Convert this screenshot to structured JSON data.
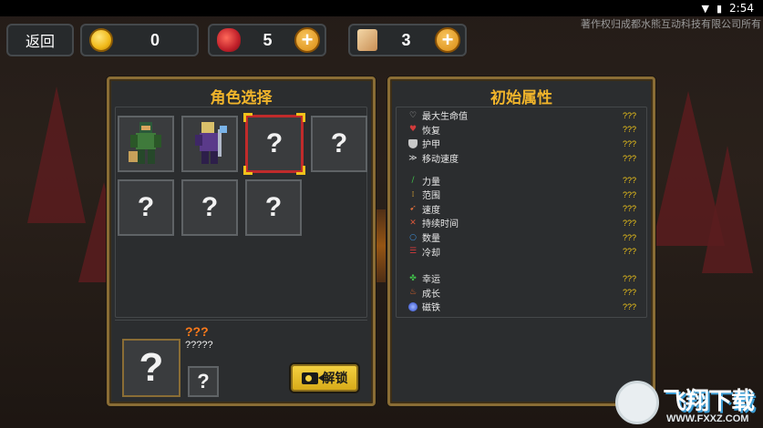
{
  "status_bar": {
    "time": "2:54"
  },
  "copyright": "著作权归成都水熊互动科技有限公司所有",
  "header": {
    "back_label": "返回",
    "gold": {
      "value": "0",
      "icon": "gold-coin-icon"
    },
    "apple": {
      "value": "5",
      "icon": "apple-icon"
    },
    "scroll": {
      "value": "3",
      "icon": "scroll-icon"
    },
    "plus_label": "+"
  },
  "character_select": {
    "title": "角色选择",
    "slots": [
      {
        "label": "",
        "state": "unlocked",
        "name": "green-warrior"
      },
      {
        "label": "",
        "state": "unlocked",
        "name": "purple-mage"
      },
      {
        "label": "?",
        "state": "selected"
      },
      {
        "label": "?",
        "state": "locked"
      },
      {
        "label": "?",
        "state": "locked"
      },
      {
        "label": "?",
        "state": "locked"
      },
      {
        "label": "?",
        "state": "locked"
      }
    ],
    "detail": {
      "big_slot": "?",
      "small_slot": "?",
      "name": "???",
      "description": "?????",
      "unlock_label": "解锁"
    }
  },
  "attributes": {
    "title": "初始属性",
    "groups": [
      [
        {
          "name": "最大生命值",
          "value": "???",
          "icon": "heart-icon",
          "color": "#bdbdbd"
        },
        {
          "name": "恢复",
          "value": "???",
          "icon": "recovery-heart-icon",
          "color": "#d23b3b"
        },
        {
          "name": "护甲",
          "value": "???",
          "icon": "armor-icon",
          "color": "#c8c8c8"
        },
        {
          "name": "移动速度",
          "value": "???",
          "icon": "wing-icon",
          "color": "#e0e0e0"
        }
      ],
      [
        {
          "name": "力量",
          "value": "???",
          "icon": "power-icon",
          "color": "#3fbf4a"
        },
        {
          "name": "范围",
          "value": "???",
          "icon": "area-icon",
          "color": "#d7a235"
        },
        {
          "name": "速度",
          "value": "???",
          "icon": "speed-icon",
          "color": "#d96b3a"
        },
        {
          "name": "持续时间",
          "value": "???",
          "icon": "duration-icon",
          "color": "#d9583a"
        },
        {
          "name": "数量",
          "value": "???",
          "icon": "amount-icon",
          "color": "#3d8fd9"
        },
        {
          "name": "冷却",
          "value": "???",
          "icon": "cooldown-icon",
          "color": "#d23b3b"
        }
      ],
      [
        {
          "name": "幸运",
          "value": "???",
          "icon": "clover-icon",
          "color": "#3fbf4a"
        },
        {
          "name": "成长",
          "value": "???",
          "icon": "growth-icon",
          "color": "#e0642a"
        },
        {
          "name": "磁铁",
          "value": "???",
          "icon": "magnet-icon",
          "color": "#3a5fd9"
        }
      ]
    ]
  },
  "watermark": {
    "main": "飞翔下载",
    "sub": "WWW.FXXZ.COM"
  }
}
